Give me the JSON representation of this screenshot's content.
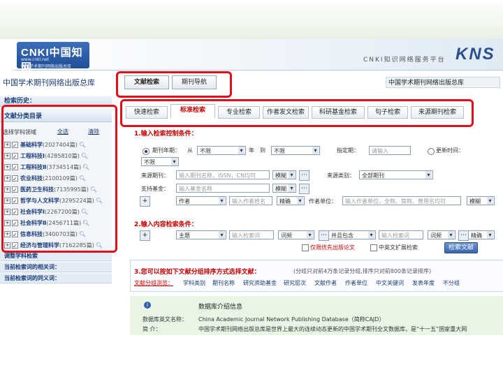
{
  "header": {
    "logo_text": "CNKI中国知网",
    "logo_sub": "www.cnki.net",
    "logo_sub2": "中国学术期刊网络出版总库",
    "platform": "CNKI知识网络服务平台",
    "kns": "KNS"
  },
  "top": {
    "site_title": "中国学术期刊网络出版总库",
    "tab_literature": "文献检索",
    "tab_journal_nav": "期刊导航",
    "db_title": "中国学术期刊网络出版总库"
  },
  "sidebar": {
    "history": "检索历史：",
    "category_title": "文献分类目录",
    "select_label": "选择学科领域",
    "select_all": "全选",
    "clear": "清除",
    "categories": [
      {
        "name": "基础科学",
        "count": "(2027404篇)"
      },
      {
        "name": "工程科技Ⅰ",
        "count": "(4285810篇)"
      },
      {
        "name": "工程科技Ⅱ",
        "count": "(3734514篇)"
      },
      {
        "name": "农业科技",
        "count": "(2100109篇)"
      },
      {
        "name": "医药卫生科技",
        "count": "(7135995篇)"
      },
      {
        "name": "哲学与人文科学",
        "count": "(3295224篇)"
      },
      {
        "name": "社会科学Ⅰ",
        "count": "(2267200篇)"
      },
      {
        "name": "社会科学Ⅱ",
        "count": "(2456711篇)"
      },
      {
        "name": "信息科技",
        "count": "(3400703篇)"
      },
      {
        "name": "经济与管理科学",
        "count": "(7162285篇)"
      }
    ],
    "bottom1": "调整学科检索",
    "bottom2": "当前检索词的相关词：",
    "bottom3": "当前检索词的同义词："
  },
  "tabs": [
    "快速检索",
    "标准检索",
    "专业检索",
    "作者发文检索",
    "科研基金检索",
    "句子检索",
    "来源期刊检索"
  ],
  "form": {
    "sec1": "1.输入检索控制条件：",
    "period": "期刊年期：",
    "from": "从",
    "from_value": "不限",
    "year": "年",
    "to": "到",
    "to_value": "不限",
    "designated": "指定期：",
    "designated_placeholder": "请输入",
    "update_time": "更新时间：",
    "update_value": "不限",
    "source_label": "来源期刊：",
    "source_placeholder": "输入期刊名称，ISSN，CN均可",
    "source_match": "模糊",
    "source_cat_label": "来源类别：",
    "source_cat_value": "全部期刊",
    "fund_label": "支持基金：",
    "fund_placeholder": "输入基金名称",
    "fund_match": "模糊",
    "author_field": "作者",
    "author_placeholder": "输入作者姓名",
    "author_match": "精确",
    "unit_label": "作者单位：",
    "unit_placeholder": "输入作者单位，全称、简称、曾用名均可",
    "unit_match": "模糊",
    "sec2": "2.输入内容检索条件：",
    "theme_field": "主题",
    "kw_placeholder": "输入检索词",
    "freq": "词频",
    "and_value": "并且包含",
    "kw2_placeholder": "输入检索词",
    "freq2": "词频",
    "precise": "精确",
    "synonym": "仅限优先出版论文",
    "cn_en": "中英文扩展检索",
    "search_btn": "检索文献",
    "sec3": "3.您可以按如下文献分组排序方式选择文献：",
    "sec3_note": "(分组只对前4万条记录分组,排序只对前800条记录排序)",
    "group_label": "文献分组浏览：",
    "group_links": [
      "学科类别",
      "期刊名称",
      "研究资助基金",
      "研究层次",
      "文献作者",
      "作者单位",
      "中文关键词",
      "发表年度",
      "不分组"
    ]
  },
  "info": {
    "title": "数据库介绍信息",
    "name_label": "数据库英文名称：",
    "name_value": "China Academic Journal Network Publishing Database（简称CAJD）",
    "intro_label": "简  介：",
    "intro_value": "中国学术期刊网络出版总库是世界上最大的连续动态更新的中国学术期刊全文数据库，是“十一五”国家重大网"
  }
}
